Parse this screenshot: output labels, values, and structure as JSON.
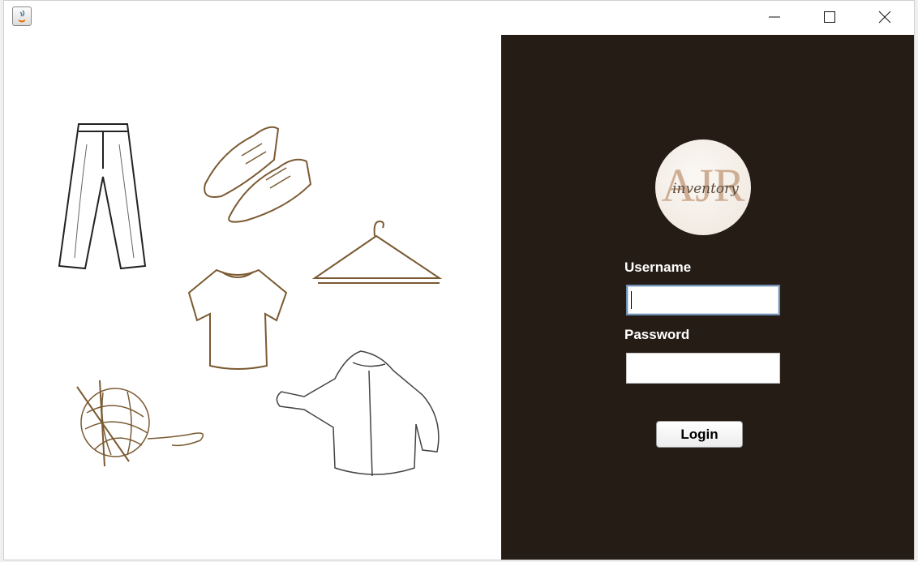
{
  "window": {
    "title": "",
    "controls": {
      "minimize_icon": "minimize-icon",
      "maximize_icon": "maximize-icon",
      "close_icon": "close-icon"
    }
  },
  "left_panel": {
    "illustrations": [
      "pants-icon",
      "shoes-icon",
      "hanger-icon",
      "tshirt-icon",
      "yarn-ball-icon",
      "jacket-icon"
    ],
    "sketch_color": "#7a5a32"
  },
  "login": {
    "logo": {
      "letters": "AJR",
      "script": "inventory"
    },
    "username_label": "Username",
    "username_value": "",
    "password_label": "Password",
    "password_value": "",
    "login_button": "Login",
    "panel_color": "#261c16"
  }
}
